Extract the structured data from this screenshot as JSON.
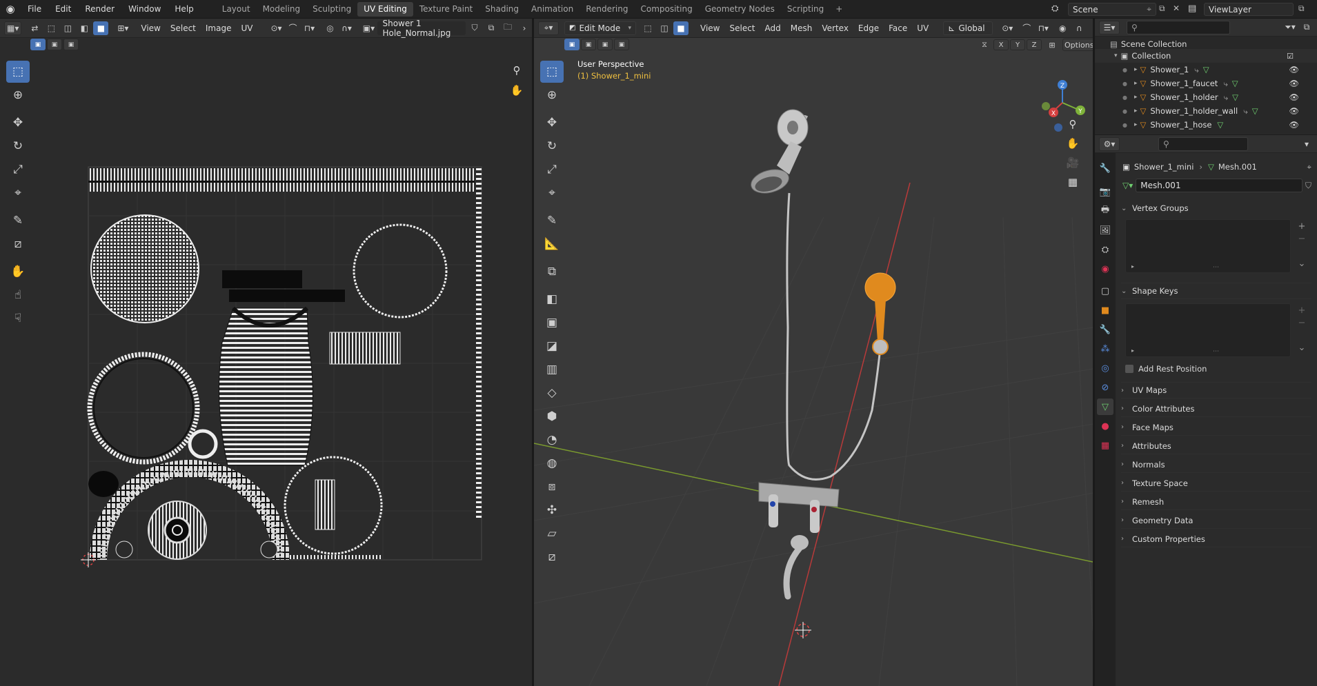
{
  "menu": {
    "items": [
      "File",
      "Edit",
      "Render",
      "Window",
      "Help"
    ]
  },
  "workspaces": {
    "tabs": [
      "Layout",
      "Modeling",
      "Sculpting",
      "UV Editing",
      "Texture Paint",
      "Shading",
      "Animation",
      "Rendering",
      "Compositing",
      "Geometry Nodes",
      "Scripting"
    ],
    "active": "UV Editing"
  },
  "scene": {
    "name": "Scene",
    "view_layer": "ViewLayer"
  },
  "uv_editor": {
    "menus": [
      "View",
      "Select",
      "Image",
      "UV"
    ],
    "image_name": "Shower 1 Hole_Normal.jpg"
  },
  "viewport": {
    "mode": "Edit Mode",
    "menus": [
      "View",
      "Select",
      "Add",
      "Mesh",
      "Vertex",
      "Edge",
      "Face",
      "UV"
    ],
    "transform_orientation": "Global",
    "options_label": "Options",
    "axis_labels": [
      "X",
      "Y",
      "Z"
    ],
    "overlay_title": "User Perspective",
    "overlay_subtitle": "(1) Shower_1_mini",
    "gizmo": {
      "x": "X",
      "y": "Y",
      "z": "Z"
    }
  },
  "outliner": {
    "scene_collection": "Scene Collection",
    "collection": "Collection",
    "objects": [
      "Shower_1",
      "Shower_1_faucet",
      "Shower_1_holder",
      "Shower_1_holder_wall",
      "Shower_1_hose"
    ]
  },
  "properties": {
    "object_name": "Shower_1_mini",
    "mesh_name": "Mesh.001",
    "mesh_field": "Mesh.001",
    "panels": {
      "vertex_groups": "Vertex Groups",
      "shape_keys": "Shape Keys",
      "add_rest_position": "Add Rest Position",
      "collapsed": [
        "UV Maps",
        "Color Attributes",
        "Face Maps",
        "Attributes",
        "Normals",
        "Texture Space",
        "Remesh",
        "Geometry Data",
        "Custom Properties"
      ]
    }
  },
  "colors": {
    "accent": "#4772b3",
    "selected_object": "#e08a1e",
    "x_axis": "#d43f3f",
    "y_axis": "#7fb33a",
    "z_axis": "#3f7fd4"
  }
}
